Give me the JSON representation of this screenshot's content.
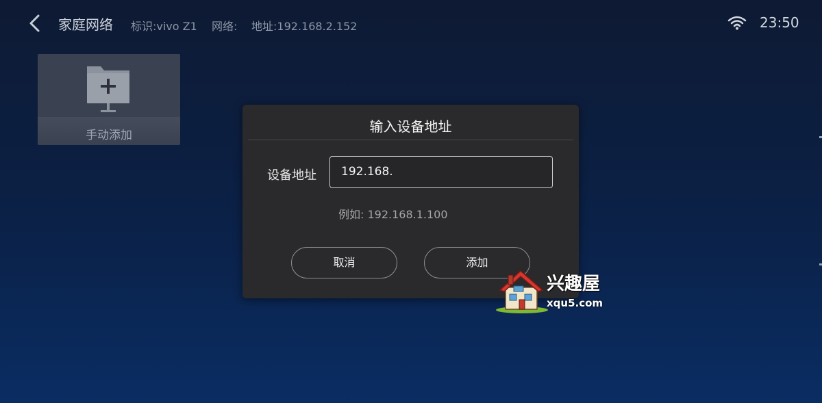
{
  "header": {
    "title": "家庭网络",
    "identifier": "标识:vivo Z1",
    "network": "网络:",
    "address": "地址:192.168.2.152",
    "time": "23:50",
    "back_icon": "chevron-left-icon",
    "wifi_icon": "wifi-icon"
  },
  "tiles": [
    {
      "label": "手动添加",
      "icon": "folder-add-icon"
    }
  ],
  "dialog": {
    "title": "输入设备地址",
    "field_label": "设备地址",
    "input_value": "192.168.",
    "example": "例如: 192.168.1.100",
    "cancel_label": "取消",
    "add_label": "添加"
  },
  "watermark": {
    "text": "兴趣屋",
    "url": "xqu5.com"
  },
  "colors": {
    "background_top": "#0e1a33",
    "background_bottom": "#0a2d63",
    "dialog_bg": "#2a2a2c"
  }
}
